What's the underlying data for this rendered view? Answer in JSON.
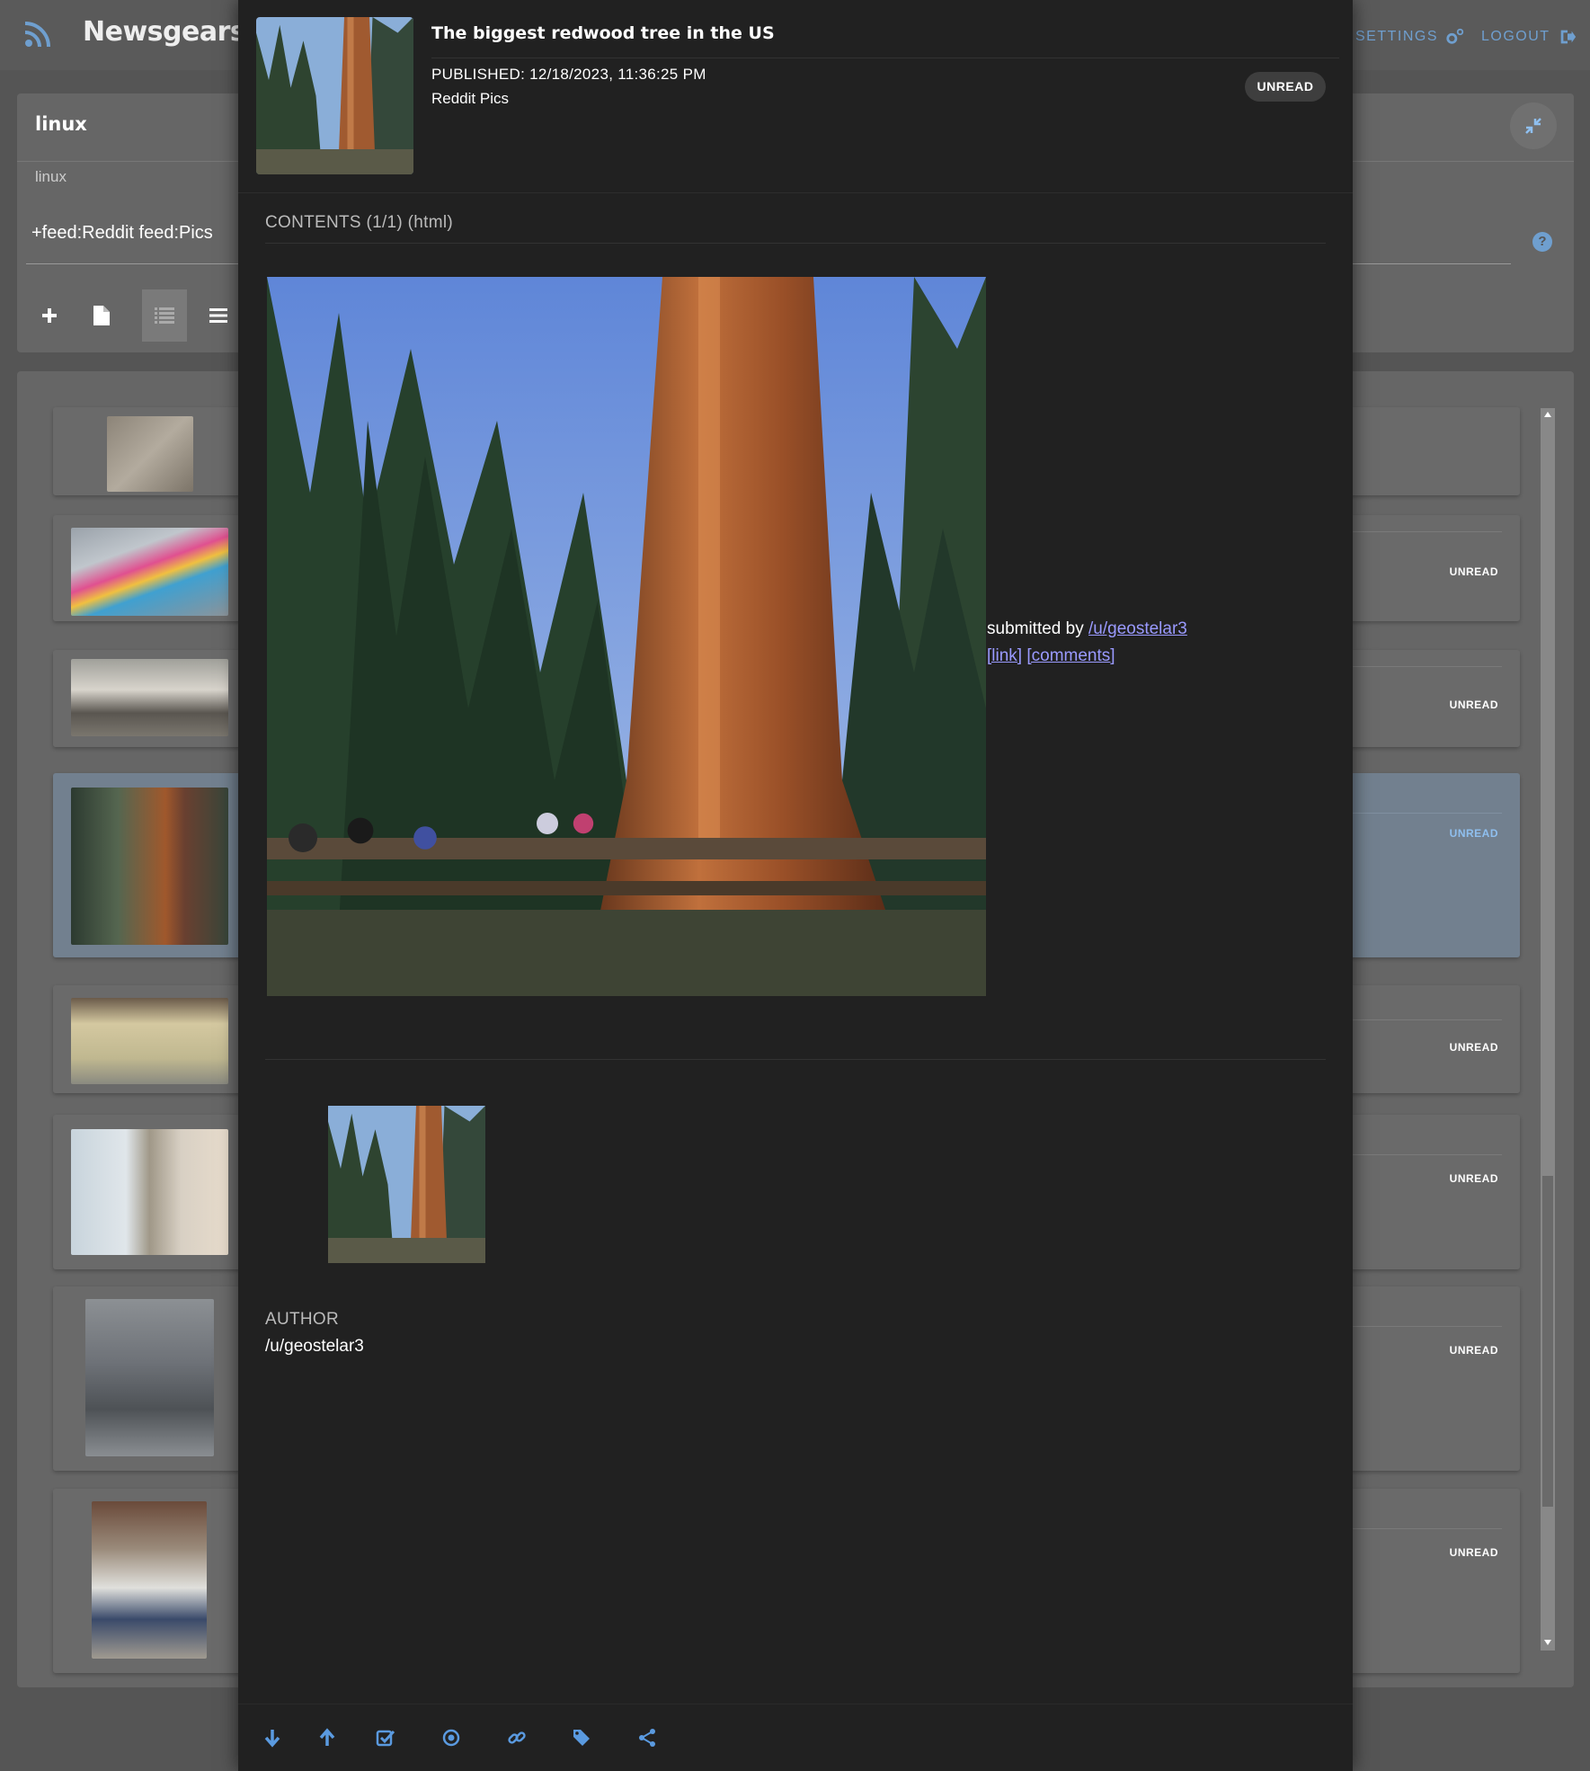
{
  "app": {
    "brand": "Newsgears",
    "nav": {
      "settings": "SETTINGS",
      "logout": "LOGOUT"
    },
    "accent": "#6f9fcf"
  },
  "stream": {
    "title": "linux",
    "subtitle": "linux",
    "query": "+feed:Reddit feed:Pics",
    "help": "?"
  },
  "list": {
    "badges": [
      "UNREAD",
      "UNREAD",
      "UNREAD",
      "UNREAD",
      "UNREAD",
      "UNREAD",
      "UNREAD"
    ]
  },
  "article": {
    "title": "The biggest redwood tree in the US",
    "published": "PUBLISHED: 12/18/2023, 11:36:25 PM",
    "feed": "Reddit Pics",
    "status": "UNREAD",
    "contents_label": "CONTENTS (1/1) (html)",
    "submitted_prefix": "submitted by",
    "submitter": "/u/geostelar3",
    "link_label": "[link]",
    "comments_label": "[comments]",
    "author_label": "AUTHOR",
    "author": "/u/geostelar3"
  },
  "footer_icons": [
    "arrow-down-icon",
    "arrow-up-icon",
    "check-square-icon",
    "target-icon",
    "link-icon",
    "tags-icon",
    "share-icon"
  ]
}
